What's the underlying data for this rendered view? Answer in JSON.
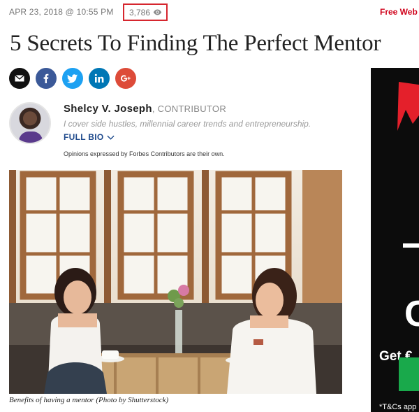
{
  "meta": {
    "date": "APR 23, 2018 @ 10:55 PM",
    "views": "3,786",
    "free_web": "Free Web"
  },
  "article": {
    "title": "5 Secrets To Finding The Perfect Mentor",
    "author_name": "Shelcy V. Joseph",
    "author_separator": ", ",
    "author_role": "CONTRIBUTOR",
    "author_bio": "I cover side hustles, millennial career trends and entrepreneurship.",
    "full_bio_label": "FULL BIO",
    "opinions": "Opinions expressed by Forbes Contributors are their own.",
    "caption": "Benefits of having a mentor (Photo by Shutterstock)"
  },
  "share_buttons": [
    {
      "icon": "email-icon",
      "color": "#111111"
    },
    {
      "icon": "facebook-icon",
      "color": "#3b5998"
    },
    {
      "icon": "twitter-icon",
      "color": "#1da1f2"
    },
    {
      "icon": "linkedin-icon",
      "color": "#0077b5"
    },
    {
      "icon": "google-plus-icon",
      "color": "#dd4b39"
    }
  ],
  "ad": {
    "big_glyph": "C",
    "get_text": "Get €",
    "tcs_text": "*T&Cs app"
  },
  "colors": {
    "accent_red": "#d0021b",
    "link_blue": "#1f4a8c",
    "ad_green": "#19a94b"
  }
}
